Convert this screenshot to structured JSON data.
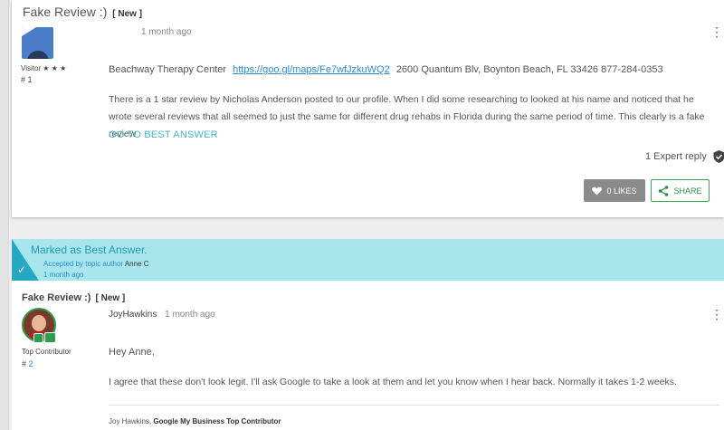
{
  "left_rail": {},
  "post1": {
    "title": "Fake Review :)",
    "new_tag": "[ New ]",
    "author_rank": "Visitor ★ ★ ★",
    "post_number": "# 1",
    "date": "1 month ago",
    "line1_prefix": "Beachway Therapy Center",
    "link": "https://goo.gl/maps/Fe7wfJzkuWQ2",
    "line1_suffix": "2600 Quantum Blv, Boynton Beach, FL 33426  877-284-0353",
    "body": "There is a 1 star review by Nicholas Anderson posted to our profile.  When I did some researching to looked at his name and noticed that he wrote several reviews that all seemed to just the same for different drug rehabs in Florida during the same period of time. This clearly is a fake review",
    "best_answer_link": "GO TO BEST ANSWER",
    "expert_reply": "1 Expert reply",
    "likes_label": "0 LIKES",
    "share_label": "SHARE"
  },
  "banner": {
    "title": "Marked as Best Answer.",
    "accepted_by": "Accepted by topic author",
    "accepted_author": "Anne C",
    "time": "1 month ago"
  },
  "post2": {
    "title": "Fake Review :)",
    "new_tag": "[ New ]",
    "author": "JoyHawkins",
    "date": "1 month ago",
    "author_rank": "Top Contributor",
    "post_number_prefix": "#",
    "post_number": "2",
    "greeting": "Hey Anne,",
    "body": "I agree that these don't look legit.  I'll ask Google to take a look at them and let you know when I hear back. Normally it takes 1-2 weeks.",
    "signature_name": "Joy Hawkins,",
    "signature_title": "Google My Business Top Contributor"
  },
  "colors": {
    "accent": "#4ab5c9",
    "banner_bg": "#a8e6ee",
    "share_green": "#2c8c4b",
    "like_grey": "#8a8a8a"
  }
}
